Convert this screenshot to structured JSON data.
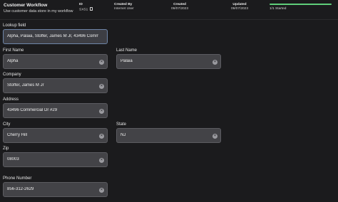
{
  "header": {
    "title": "Customer Workflow",
    "subtitle": "Use customer data store in my workflow",
    "id_label": "ID",
    "id_value": "SXS1",
    "created_by_label": "Created By",
    "created_by_value": "Internet User",
    "created_label": "Created",
    "created_value": "09/07/2023",
    "updated_label": "Updated",
    "updated_value": "09/07/2023",
    "progress_text": "1/1 Started",
    "progress_fraction": 1.0,
    "accent_color": "#5fce7a"
  },
  "form": {
    "lookup": {
      "label": "Lookup field",
      "value": "Alpha, Palaia, Stoffer, James M Jr, 43496 Commercial Dr #29, Cherry Hill, NJ, 08003, 856-312-2629"
    },
    "first_name": {
      "label": "First Name",
      "value": "Alpha"
    },
    "last_name": {
      "label": "Last Name",
      "value": "Palaia"
    },
    "company": {
      "label": "Company",
      "value": "Stoffer, James M Jr"
    },
    "address": {
      "label": "Address",
      "value": "43496 Commercial Dr #29"
    },
    "city": {
      "label": "City",
      "value": "Cherry Hill"
    },
    "state": {
      "label": "State",
      "value": "NJ"
    },
    "zip": {
      "label": "Zip",
      "value": "08003"
    },
    "phone": {
      "label": "Phone Number",
      "value": "856-312-2629"
    }
  },
  "icons": {
    "clear": "clear-circle-icon",
    "copy": "copy-icon"
  }
}
